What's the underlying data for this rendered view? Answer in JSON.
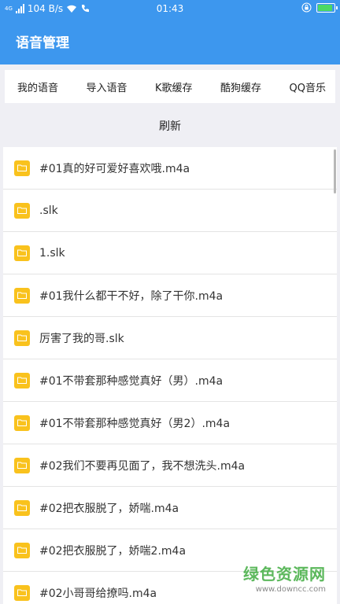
{
  "status_bar": {
    "signal_tag": "4G",
    "speed": "104 B/s",
    "time": "01:43",
    "icons": [
      "signal-icon",
      "wifi-icon",
      "hd-call-icon",
      "lock-rotation-icon",
      "battery-charging-icon"
    ],
    "battery_level": 0.9
  },
  "app_bar": {
    "title": "语音管理"
  },
  "tabs": [
    {
      "label": "我的语音"
    },
    {
      "label": "导入语音"
    },
    {
      "label": "K歌缓存"
    },
    {
      "label": "酷狗缓存"
    },
    {
      "label": "QQ音乐"
    }
  ],
  "refresh_label": "刷新",
  "files": [
    {
      "name": "#01真的好可爱好喜欢哦.m4a"
    },
    {
      "name": ".slk"
    },
    {
      "name": "1.slk"
    },
    {
      "name": "#01我什么都干不好，除了干你.m4a"
    },
    {
      "name": "厉害了我的哥.slk"
    },
    {
      "name": "#01不带套那种感觉真好（男）.m4a"
    },
    {
      "name": "#01不带套那种感觉真好（男2）.m4a"
    },
    {
      "name": "#02我们不要再见面了，我不想洗头.m4a"
    },
    {
      "name": "#02把衣服脱了，娇喘.m4a"
    },
    {
      "name": "#02把衣服脱了，娇喘2.m4a"
    },
    {
      "name": "#02小哥哥给撩吗.m4a"
    }
  ],
  "file_icon": "folder-icon",
  "watermark": {
    "title": "绿色资源网",
    "url": "www.downcc.com"
  },
  "colors": {
    "accent": "#3d97ee",
    "folder": "#f9c21d",
    "background": "#efeff4",
    "watermark": "#5cb85c"
  }
}
